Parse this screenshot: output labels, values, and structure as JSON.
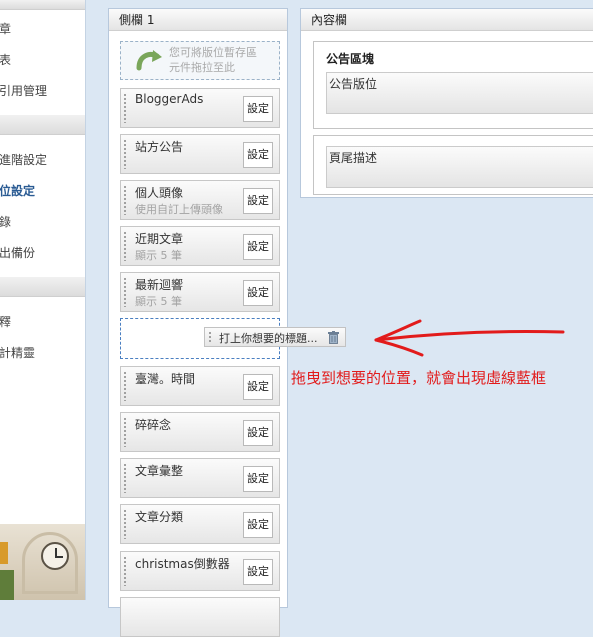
{
  "nav": {
    "items": [
      "章",
      "表",
      "引用管理",
      "進階設定",
      "位設定",
      "錄",
      "出備份",
      "釋",
      "計精靈"
    ]
  },
  "sidebar": {
    "title": "側欄 1",
    "drop_hint_line1": "您可將版位暫存區",
    "drop_hint_line2": "元件拖拉至此",
    "settings_label": "設定",
    "gadgets": [
      {
        "name": "BloggerAds",
        "sub": ""
      },
      {
        "name": "站方公告",
        "sub": ""
      },
      {
        "name": "個人頭像",
        "sub": "使用自訂上傳頭像"
      },
      {
        "name": "近期文章",
        "sub": "顯示 5 筆"
      },
      {
        "name": "最新迴響",
        "sub": "顯示 5 筆"
      },
      {
        "name": "臺灣。時間",
        "sub": ""
      },
      {
        "name": "碎碎念",
        "sub": ""
      },
      {
        "name": "文章彙整",
        "sub": ""
      },
      {
        "name": "文章分類",
        "sub": ""
      },
      {
        "name": "christmas倒數器",
        "sub": ""
      }
    ],
    "dragging_label": "打上你想要的標題..."
  },
  "content": {
    "title": "內容欄",
    "announce_section": "公告區塊",
    "announce_slot": "公告版位",
    "footer_section": "頁尾描述"
  },
  "annotation": {
    "text": "拖曳到想要的位置，就會出現虛線藍框",
    "color": "#e21b1b"
  },
  "colors": {
    "background": "#dbe7f3",
    "drop_border": "#4a7fc1"
  }
}
